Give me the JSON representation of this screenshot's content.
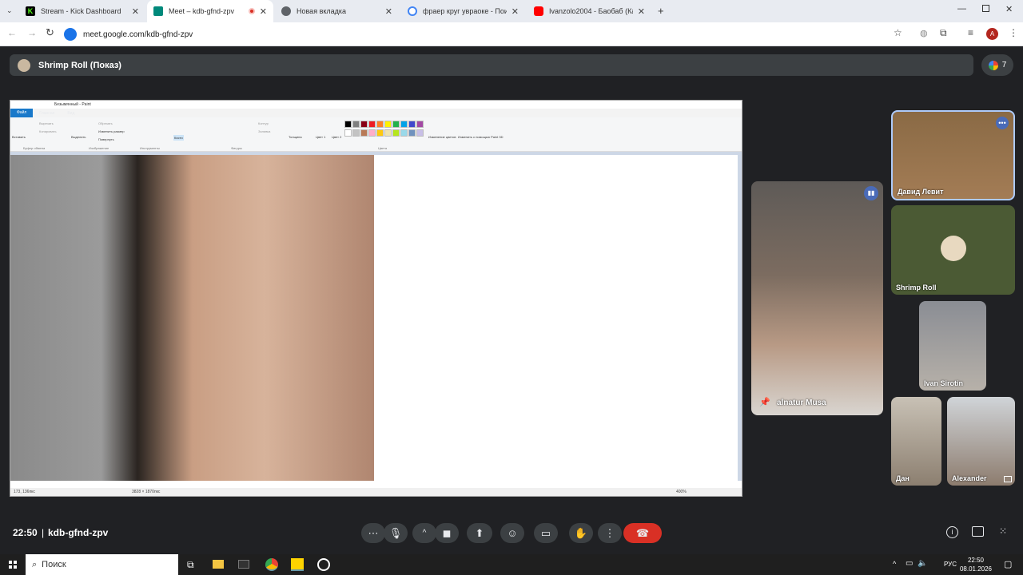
{
  "browser": {
    "tabs": [
      {
        "title": "Stream - Kick Dashboard",
        "fav_color": "#53fc18"
      },
      {
        "title": "Meet – kdb-gfnd-zpv",
        "fav_color": "#00897b"
      },
      {
        "title": "Новая вкладка",
        "fav_color": "#5f6368"
      },
      {
        "title": "фраер круг увраоке - Поиск в",
        "fav_color": "#4285f4"
      },
      {
        "title": "Ivanzolo2004 - Баобаб (Карао",
        "fav_color": "#ff0000"
      }
    ],
    "url": "meet.google.com/kdb-gfnd-zpv",
    "profile_initial": "A"
  },
  "meet": {
    "presenter_label": "Shrimp Roll (Показ)",
    "participant_count": "7",
    "time": "22:50",
    "meeting_code": "kdb-gfnd-zpv",
    "participants": [
      {
        "name": "Давид Левит"
      },
      {
        "name": "Shrimp Roll"
      },
      {
        "name": "Ivan Sirotin"
      },
      {
        "name": "alnatur Musa"
      },
      {
        "name": "Дан"
      },
      {
        "name": "Alexander"
      }
    ]
  },
  "paint": {
    "title": "Безымянный - Paint",
    "ribbon_tabs": [
      "Файл",
      "Главная",
      "Вид"
    ],
    "groups": [
      "Буфер обмена",
      "Изображение",
      "Инструменты",
      "Фигуры",
      "Цвета"
    ],
    "buttons": {
      "paste": "Вставить",
      "cut": "Вырезать",
      "copy": "Копировать",
      "select": "Выделить",
      "crop": "Обрезать",
      "resize": "Изменить размер",
      "rotate": "Повернуть",
      "brushes": "Кисти",
      "outline": "Контур",
      "fill": "Заливка",
      "size": "Толщина",
      "color1": "Цвет 1",
      "color2": "Цвет 2",
      "edit_colors": "Изменение цветов",
      "paint3d": "Изменить с помощью Paint 3D"
    },
    "status": {
      "cursor": "173, 136пкс",
      "canvas_size": "3828 × 1870пкс",
      "zoom": "400%"
    },
    "palette": [
      "#000000",
      "#7f7f7f",
      "#880015",
      "#ed1c24",
      "#ff7f27",
      "#fff200",
      "#22b14c",
      "#00a2e8",
      "#3f48cc",
      "#a349a4",
      "#ffffff",
      "#c3c3c3",
      "#b97a57",
      "#ffaec9",
      "#ffc90e",
      "#efe4b0",
      "#b5e61d",
      "#99d9ea",
      "#7092be",
      "#c8bfe7"
    ]
  },
  "taskbar": {
    "search": "Поиск",
    "lang": "РУС",
    "time": "22:50",
    "date": "08.01.2026"
  }
}
